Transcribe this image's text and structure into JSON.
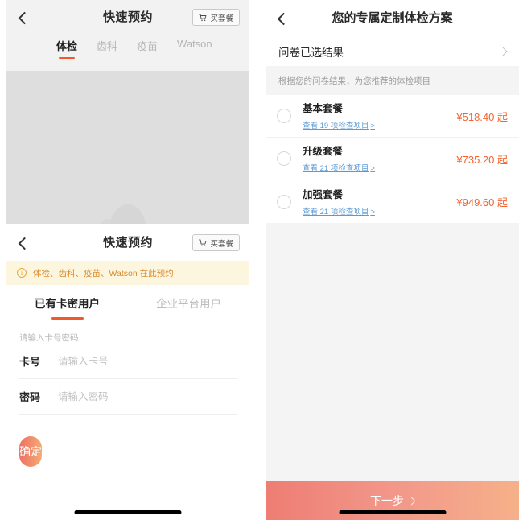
{
  "quick_booking_top": {
    "nav": {
      "back_icon": "chevron-left-icon",
      "title": "快速预约",
      "buy_button": "买套餐",
      "cart_icon": "shopping-cart-icon"
    },
    "tabs": [
      {
        "label": "体检",
        "active": true
      },
      {
        "label": "齿科",
        "active": false
      },
      {
        "label": "疫苗",
        "active": false
      },
      {
        "label": "Watson",
        "active": false
      }
    ],
    "accent_color": "#f1592a",
    "stage_placeholder_color": "#dedede"
  },
  "card_login": {
    "nav": {
      "back_icon": "chevron-left-icon",
      "title": "快速预约",
      "buy_button": "买套餐",
      "cart_icon": "shopping-cart-icon"
    },
    "banner": {
      "icon": "info-circle-icon",
      "text": "体检、齿科、疫苗、Watson 在此预约",
      "bg_color": "#fdf6df",
      "text_color": "#d98a2b"
    },
    "tabs": [
      {
        "label": "已有卡密用户",
        "active": true
      },
      {
        "label": "企业平台用户",
        "active": false
      }
    ],
    "form": {
      "hint": "请输入卡号密码",
      "fields": [
        {
          "label": "卡号",
          "value": "",
          "placeholder": "请输入卡号"
        },
        {
          "label": "密码",
          "value": "",
          "placeholder": "请输入密码"
        }
      ],
      "submit_label": "确定"
    }
  },
  "plan": {
    "nav": {
      "back_icon": "chevron-left-icon",
      "title": "您的专属定制体检方案"
    },
    "questionnaire_row": {
      "label": "问卷已选结果",
      "chevron_icon": "chevron-right-icon"
    },
    "section_note": "根据您的问卷结果，为您推荐的体检项目",
    "packages": [
      {
        "name": "基本套餐",
        "detail_link": "查看 19 项检查项目",
        "link_arrow": ">",
        "price": "¥518.40 起",
        "selected": false
      },
      {
        "name": "升级套餐",
        "detail_link": "查看 21 项检查项目",
        "link_arrow": ">",
        "price": "¥735.20 起",
        "selected": false
      },
      {
        "name": "加强套餐",
        "detail_link": "查看 21 项检查项目",
        "link_arrow": ">",
        "price": "¥949.60 起",
        "selected": false
      }
    ],
    "cta": {
      "label": "下一步",
      "chevron_icon": "chevron-right-icon"
    },
    "price_color": "#f2642f",
    "link_color": "#5b9bd5"
  }
}
